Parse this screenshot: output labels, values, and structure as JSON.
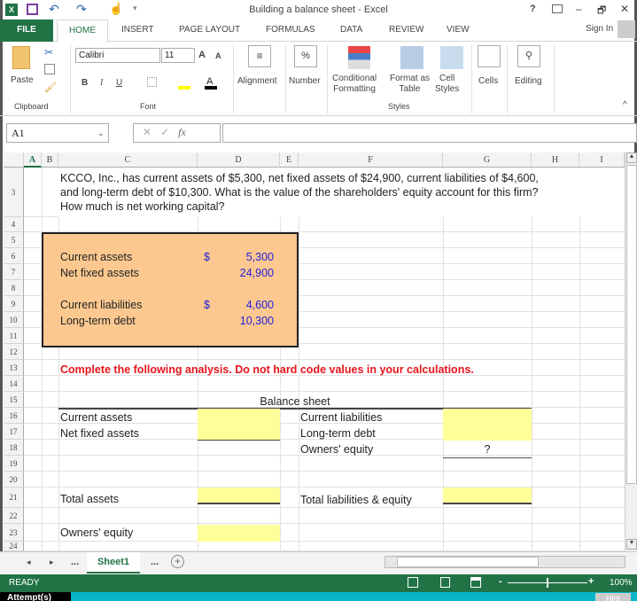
{
  "window": {
    "title": "Building a balance sheet - Excel",
    "help": "?",
    "minimize": "–",
    "restore": "🗗",
    "close": "✕",
    "sign_in": "Sign In"
  },
  "tabs": [
    "FILE",
    "HOME",
    "INSERT",
    "PAGE LAYOUT",
    "FORMULAS",
    "DATA",
    "REVIEW",
    "VIEW"
  ],
  "ribbon": {
    "paste": "Paste",
    "font_name": "Calibri",
    "font_size": "11",
    "bold": "B",
    "italic": "I",
    "underline": "U",
    "alignment": "Alignment",
    "number": "Number",
    "percent": "%",
    "conditional": [
      "Conditional",
      "Formatting"
    ],
    "format_table": [
      "Format as",
      "Table"
    ],
    "cell_styles": [
      "Cell",
      "Styles"
    ],
    "cells": "Cells",
    "editing": "Editing",
    "groups": {
      "clipboard": "Clipboard",
      "font": "Font",
      "styles": "Styles"
    }
  },
  "formula_bar": {
    "name_box": "A1",
    "fx": "fx",
    "value": ""
  },
  "columns": [
    "A",
    "B",
    "C",
    "D",
    "E",
    "F",
    "G",
    "H",
    "I"
  ],
  "rows": [
    "3",
    "4",
    "5",
    "6",
    "7",
    "8",
    "9",
    "10",
    "11",
    "12",
    "13",
    "14",
    "15",
    "16",
    "17",
    "18",
    "19",
    "20",
    "21",
    "22",
    "23",
    "24"
  ],
  "sheet": {
    "question": [
      "KCCO, Inc., has current assets of $5,300, net fixed assets of $24,900, current liabilities of $4,600,",
      "and long-term debt of $10,300. What is the value of the shareholders' equity account for this firm?",
      "How much is net working capital?"
    ],
    "given": [
      {
        "label": "Current assets",
        "currency": "$",
        "value": "5,300"
      },
      {
        "label": "Net fixed assets",
        "value": "24,900"
      },
      {
        "label": "Current liabilities",
        "currency": "$",
        "value": "4,600"
      },
      {
        "label": "Long-term debt",
        "value": "10,300"
      }
    ],
    "instruction": "Complete the following analysis. Do not hard code values in your calculations.",
    "bs_title": "Balance sheet",
    "bs_left": [
      "Current assets",
      "Net fixed assets",
      "Total assets",
      "Owners' equity"
    ],
    "bs_right": [
      "Current liabilities",
      "Long-term debt",
      "Owners' equity",
      "Total liabilities & equity"
    ],
    "question_mark": "?"
  },
  "sheet_tabs": {
    "prev": "◂",
    "next": "▸",
    "ellipsis": "...",
    "active": "Sheet1",
    "add": "+"
  },
  "status": {
    "ready": "READY",
    "zoom": "100%",
    "minus": "-",
    "plus": "+"
  },
  "footer": {
    "attempts": "Attempt(s)",
    "hint": "Hint"
  }
}
